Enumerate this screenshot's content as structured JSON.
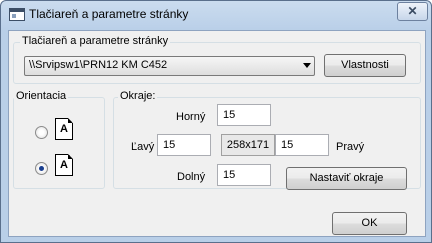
{
  "window": {
    "title": "Tlačiareň a parametre stránky",
    "close_glyph": "✕"
  },
  "printer_group": {
    "legend": "Tlačiareň a parametre stránky",
    "selected_printer": "\\\\Srvipsw1\\PRN12 KM C452",
    "properties_label": "Vlastnosti"
  },
  "orientation_group": {
    "legend": "Orientacia",
    "portrait_letter": "A",
    "landscape_letter": "A",
    "selected": "landscape"
  },
  "margins_group": {
    "legend": "Okraje:",
    "top_label": "Horný",
    "top_value": "15",
    "left_label": "Ľavý",
    "left_value": "15",
    "dimensions": "258x171",
    "right_value": "15",
    "right_label": "Pravý",
    "bottom_label": "Dolný",
    "bottom_value": "15",
    "set_margins_label": "Nastaviť okraje"
  },
  "footer": {
    "ok_label": "OK"
  }
}
